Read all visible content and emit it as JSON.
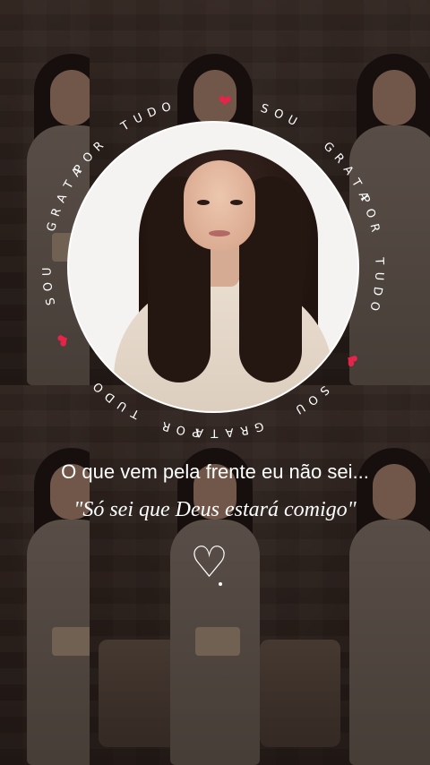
{
  "image": {
    "ring_text_segments": [
      "SOU",
      "GRATA",
      "POR",
      "TUDO",
      "SOU",
      "GRATA",
      "POR",
      "TUDO",
      "SOU",
      "GRATA",
      "POR",
      "TUDO"
    ],
    "ring_heart_icon": "heart-icon",
    "ring_heart_color": "#e8234a",
    "ring_text_color": "#ffffff",
    "caption_line1": "O que vem pela frente eu não sei...",
    "caption_line2": "\"Só sei que Deus estará comigo\"",
    "doodle_icon": "heart-outline-icon"
  }
}
